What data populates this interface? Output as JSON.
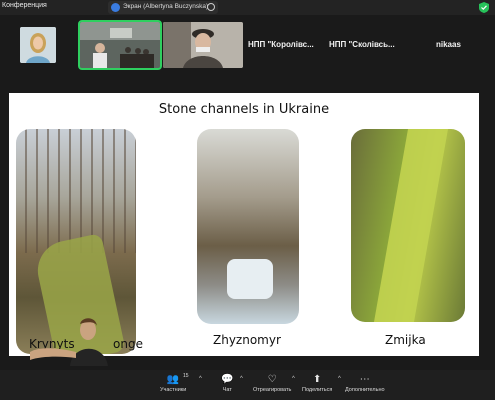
{
  "window": {
    "title": "Конференция"
  },
  "share_bar": {
    "text": "Экран (Albertyna Buczynska)"
  },
  "participants": [
    {
      "name": "НПП \"Королівс..."
    },
    {
      "name": "НПП \"Сколівсь..."
    },
    {
      "name": "nikaas"
    }
  ],
  "slide": {
    "title": "Stone channels in Ukraine",
    "captions": [
      "Krynyts",
      "onge",
      "Zhyznomyr",
      "Zmijka"
    ]
  },
  "toolbar": {
    "participants_label": "Участники",
    "participants_count": "15",
    "chat_label": "Чат",
    "react_label": "Отреагировать",
    "share_label": "Поделиться",
    "more_label": "Дополнительно"
  },
  "colors": {
    "active_speaker": "#2fcf5f",
    "share_icon": "#3a7ce0",
    "shield": "#27c25a"
  }
}
